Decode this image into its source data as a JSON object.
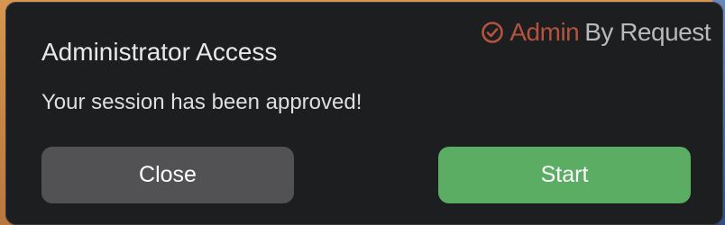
{
  "brand": {
    "name_part1": "Admin",
    "name_part2": "By Request",
    "icon": "check-circle-icon",
    "accent_color": "#b5533f"
  },
  "dialog": {
    "title": "Administrator Access",
    "message": "Your session has been approved!"
  },
  "buttons": {
    "close_label": "Close",
    "start_label": "Start",
    "start_color": "#5aad63",
    "close_color": "#525254"
  }
}
